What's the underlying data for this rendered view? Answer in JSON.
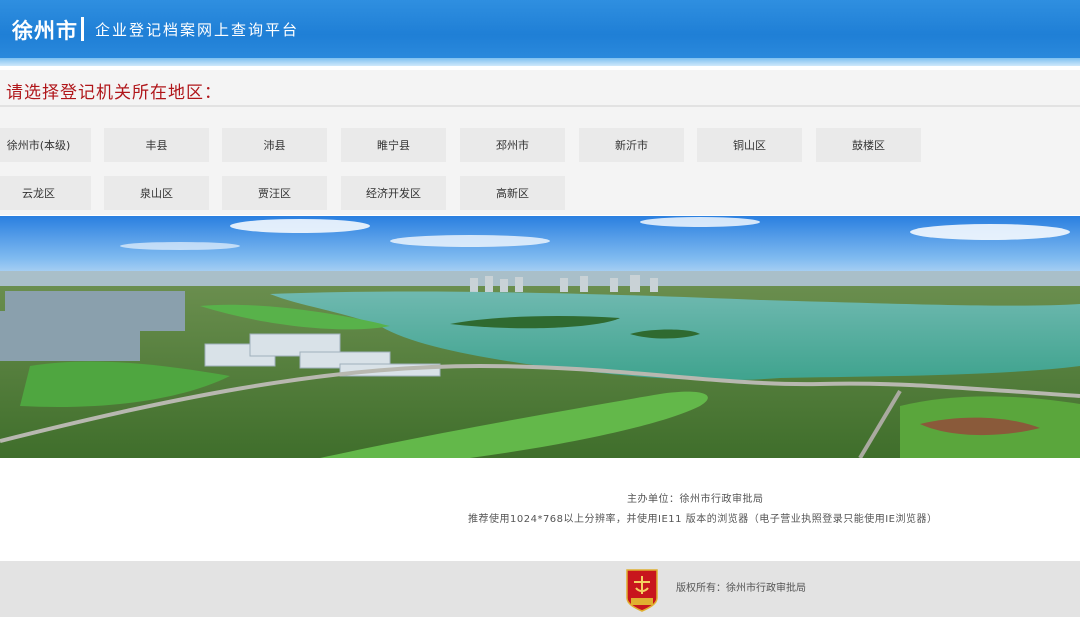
{
  "header": {
    "city": "徐州市",
    "platform": "企业登记档案网上查询平台"
  },
  "region": {
    "title": "请选择登记机关所在地区：",
    "items": [
      "徐州市(本级)",
      "丰县",
      "沛县",
      "睢宁县",
      "邳州市",
      "新沂市",
      "铜山区",
      "鼓楼区",
      "云龙区",
      "泉山区",
      "贾汪区",
      "经济开发区",
      "高新区"
    ]
  },
  "info": {
    "host": "主办单位：徐州市行政审批局",
    "recommend": "推荐使用1024*768以上分辨率，并使用IE11 版本的浏览器（电子营业执照登录只能使用IE浏览器）"
  },
  "footer": {
    "copyright": "版权所有：徐州市行政审批局",
    "emblem_text": "审批机关"
  },
  "colors": {
    "header_blue": "#1f7fd6",
    "title_red": "#b0161a",
    "emblem_red": "#c8161d"
  }
}
